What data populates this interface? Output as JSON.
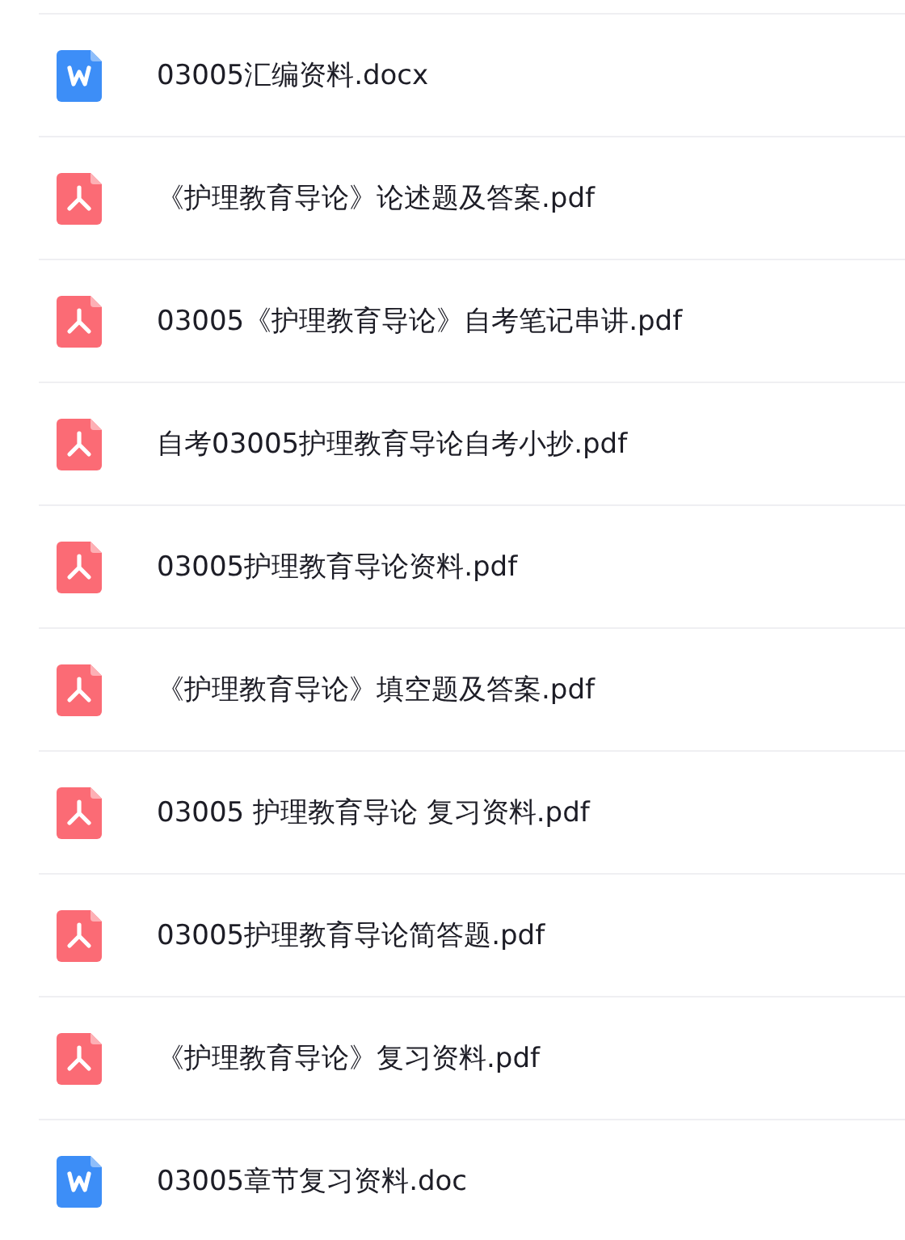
{
  "files": [
    {
      "kind": "word",
      "name": "03005汇编资料.docx"
    },
    {
      "kind": "pdf",
      "name": "《护理教育导论》论述题及答案.pdf"
    },
    {
      "kind": "pdf",
      "name": "03005《护理教育导论》自考笔记串讲.pdf"
    },
    {
      "kind": "pdf",
      "name": "自考03005护理教育导论自考小抄.pdf"
    },
    {
      "kind": "pdf",
      "name": "03005护理教育导论资料.pdf"
    },
    {
      "kind": "pdf",
      "name": "《护理教育导论》填空题及答案.pdf"
    },
    {
      "kind": "pdf",
      "name": "03005 护理教育导论 复习资料.pdf"
    },
    {
      "kind": "pdf",
      "name": "03005护理教育导论简答题.pdf"
    },
    {
      "kind": "pdf",
      "name": "《护理教育导论》复习资料.pdf"
    },
    {
      "kind": "word",
      "name": "03005章节复习资料.doc"
    }
  ]
}
